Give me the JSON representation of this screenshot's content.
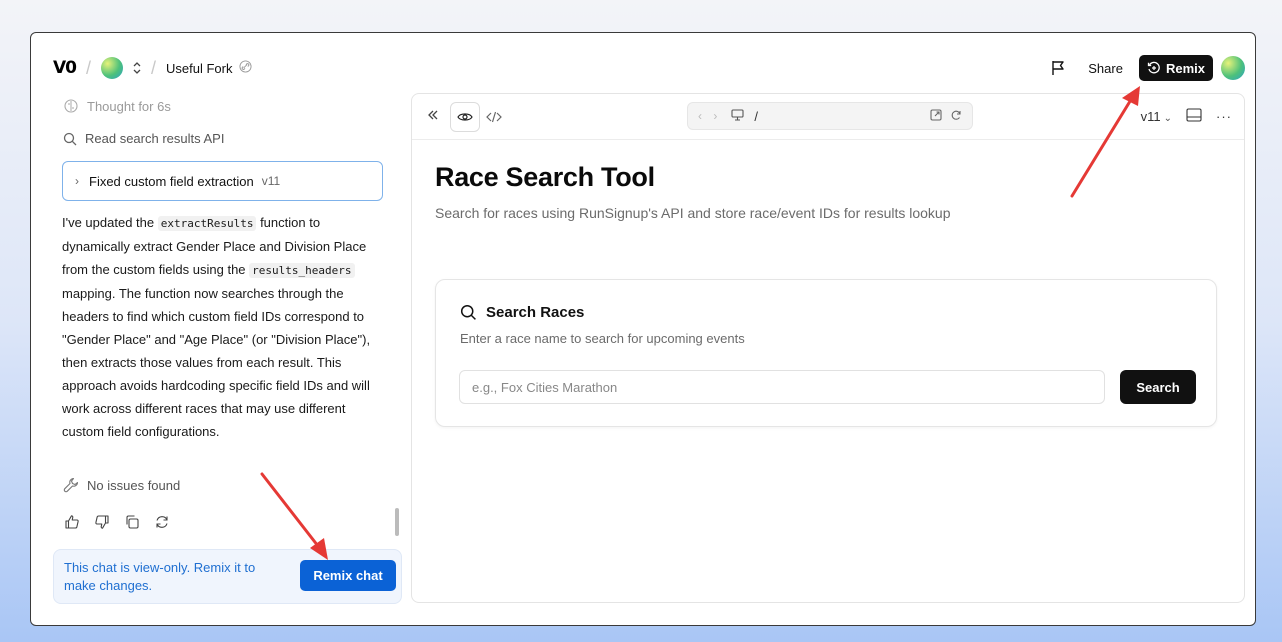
{
  "topbar": {
    "logo": "V0",
    "project_name": "Useful Fork",
    "share_label": "Share",
    "remix_label": "Remix"
  },
  "chat": {
    "thought": "Thought for 6s",
    "read_step": "Read search results API",
    "step_title": "Fixed custom field extraction",
    "step_version": "v11",
    "message": {
      "p1": "I've updated the ",
      "code1": "extractResults",
      "p2": " function to dynamically extract Gender Place and Division Place from the custom fields using the ",
      "code2": "results_headers",
      "p3": " mapping. The function now searches through the headers to find which custom field IDs correspond to \"Gender Place\" and \"Age Place\" (or \"Division Place\"), then extracts those values from each result. This approach avoids hardcoding specific field IDs and will work across different races that may use different custom field configurations."
    },
    "no_issues": "No issues found",
    "notice_text": "This chat is view-only. Remix it to make changes.",
    "remix_chat_label": "Remix chat"
  },
  "preview": {
    "url_path": "/",
    "version_label": "v11",
    "title": "Race Search Tool",
    "subtitle": "Search for races using RunSignup's API and store race/event IDs for results lookup",
    "card": {
      "title": "Search Races",
      "subtitle": "Enter a race name to search for upcoming events",
      "input_value": "",
      "input_placeholder": "e.g., Fox Cities Marathon",
      "button_label": "Search"
    }
  },
  "colors": {
    "accent_blue": "#0b62d6",
    "annotation_red": "#e53935",
    "dark_button": "#111111"
  }
}
